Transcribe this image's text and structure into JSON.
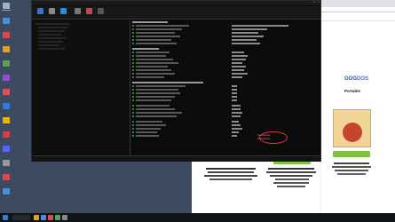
{
  "desktop": {
    "icons": [
      {
        "label": "Recycle Bin",
        "icon": "recycle-bin-icon",
        "color": "#9fb3c8"
      },
      {
        "label": "",
        "icon": "app-icon",
        "color": "#4a90d9"
      },
      {
        "label": "",
        "icon": "app-icon",
        "color": "#d94a4a"
      },
      {
        "label": "",
        "icon": "app-icon",
        "color": "#e0a030"
      },
      {
        "label": "",
        "icon": "app-icon",
        "color": "#5aa055"
      },
      {
        "label": "",
        "icon": "app-icon",
        "color": "#8855cc"
      },
      {
        "label": "",
        "icon": "app-icon",
        "color": "#d9534f"
      },
      {
        "label": "",
        "icon": "app-icon",
        "color": "#2f7cd1"
      },
      {
        "label": "",
        "icon": "app-icon",
        "color": "#e6b800"
      },
      {
        "label": "",
        "icon": "app-icon",
        "color": "#c44"
      },
      {
        "label": "",
        "icon": "app-icon",
        "color": "#5865f2"
      },
      {
        "label": "",
        "icon": "app-icon",
        "color": "#999"
      },
      {
        "label": "",
        "icon": "app-icon",
        "color": "#d94a4a"
      },
      {
        "label": "",
        "icon": "app-icon",
        "color": "#4a90d9"
      }
    ]
  },
  "app": {
    "title": "",
    "toolbar_items": [
      {
        "label": "",
        "icon": "report-icon",
        "color": "#3c6fcf"
      },
      {
        "label": "",
        "icon": "compare-icon",
        "color": "#888"
      },
      {
        "label": "",
        "icon": "monitor-icon",
        "color": "#2e8bd8"
      },
      {
        "label": "",
        "icon": "tools-icon",
        "color": "#777"
      },
      {
        "label": "",
        "icon": "favorites-icon",
        "color": "#cc4444"
      },
      {
        "label": "",
        "icon": "settings-icon",
        "color": "#555"
      }
    ],
    "highlight_value_1": "Not Attached",
    "highlight_value_2": "Not Attached",
    "status": ""
  },
  "browser": {
    "brand_prefix": "GOG",
    "brand_suffix": "DOS",
    "product_title": "Portable",
    "subtitle_1": "",
    "subtitle_2": "",
    "box_title": "",
    "buy_label": "",
    "cta_label": ""
  },
  "taskbar": {
    "time": "",
    "date": ""
  }
}
